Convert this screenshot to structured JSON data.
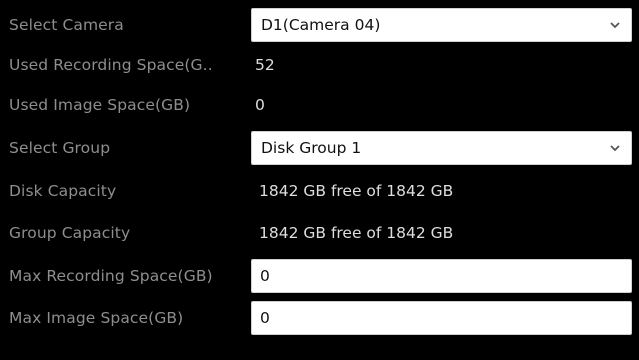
{
  "fields": {
    "select_camera": {
      "label": "Select Camera",
      "value": "D1(Camera 04)"
    },
    "used_recording_space": {
      "label": "Used Recording Space(G..",
      "value": "52"
    },
    "used_image_space": {
      "label": "Used Image Space(GB)",
      "value": "0"
    },
    "select_group": {
      "label": "Select Group",
      "value": "Disk Group 1"
    },
    "disk_capacity": {
      "label": "Disk Capacity",
      "value": "1842 GB free of 1842 GB"
    },
    "group_capacity": {
      "label": "Group Capacity",
      "value": "1842 GB free of 1842 GB"
    },
    "max_recording_space": {
      "label": "Max Recording Space(GB)",
      "value": "0"
    },
    "max_image_space": {
      "label": "Max Image Space(GB)",
      "value": "0"
    }
  },
  "icons": {
    "dropdown": "chevron-down-icon"
  },
  "colors": {
    "background": "#000000",
    "label": "#8e8e8e",
    "value": "#dedede",
    "control_bg": "#ffffff",
    "control_text": "#111111"
  }
}
